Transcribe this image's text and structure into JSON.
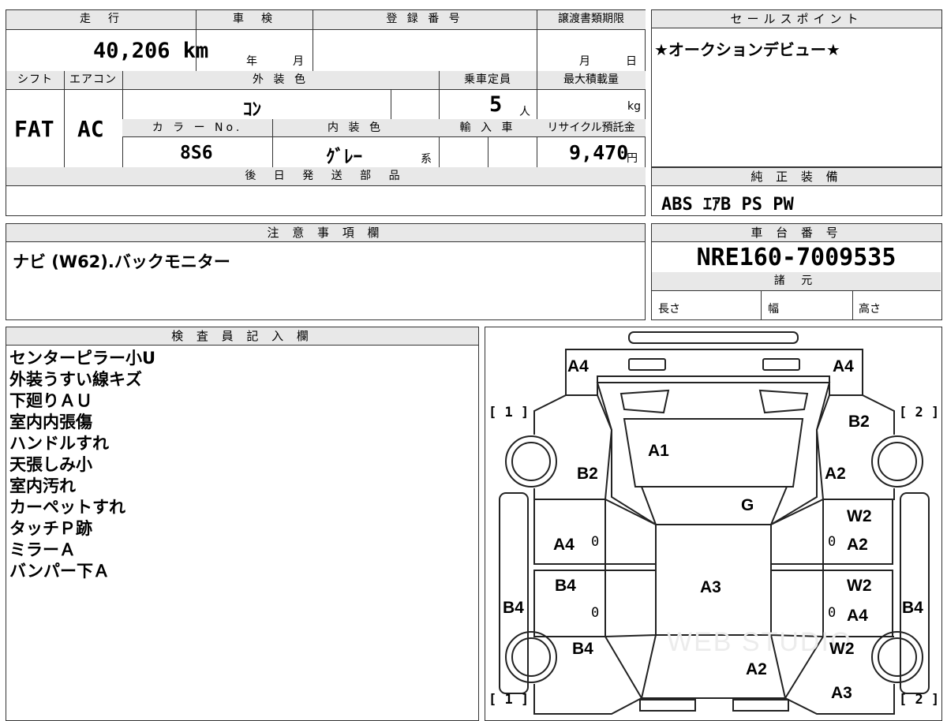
{
  "top_table": {
    "mileage": {
      "header": "走　行",
      "value": "40,206 km"
    },
    "inspection": {
      "header": "車　検",
      "year_unit": "年",
      "month_unit": "月"
    },
    "registration": {
      "header": "登 録 番 号",
      "value": ""
    },
    "transfer_deadline": {
      "header": "譲渡書類期限",
      "month_unit": "月",
      "day_unit": "日"
    },
    "shift": {
      "header": "シフト",
      "value": "FAT"
    },
    "aircon": {
      "header": "エアコン",
      "value": "AC"
    },
    "exterior_color": {
      "header": "外 装 色",
      "value": "ｺﾝ"
    },
    "capacity": {
      "header": "乗車定員",
      "value": "5",
      "unit": "人"
    },
    "max_load": {
      "header": "最大積載量",
      "unit": "kg"
    },
    "color_no": {
      "header": "カ ラ ー No.",
      "value": "8S6"
    },
    "interior_color": {
      "header": "内 装 色",
      "value": "ｸﾞﾚｰ",
      "suffix": "系"
    },
    "import": {
      "header": "輸 入 車"
    },
    "recycle_fee": {
      "header": "リサイクル預託金",
      "value": "9,470",
      "unit": "円"
    },
    "later_parts": {
      "header": "後 日 発 送 部 品",
      "value": ""
    }
  },
  "sales_point": {
    "header": "セールスポイント",
    "text": "★オークションデビュー★"
  },
  "genuine_equipment": {
    "header": "純 正 装 備",
    "text": "ABS ｴｱB PS PW"
  },
  "notes": {
    "header": "注 意 事 項 欄",
    "text": "ナビ (W62).バックモニター"
  },
  "chassis": {
    "header": "車 台 番 号",
    "value": "NRE160-7009535"
  },
  "specs": {
    "header": "諸 元",
    "length_label": "長さ",
    "width_label": "幅",
    "height_label": "高さ"
  },
  "inspector": {
    "header": "検 査 員 記 入 欄",
    "lines": [
      "センターピラー小U",
      "外装うすい線キズ",
      "下廻りＡＵ",
      "室内内張傷",
      "ハンドルすれ",
      "天張しみ小",
      "室内汚れ",
      "カーペットすれ",
      "タッチＰ跡",
      "ミラーＡ",
      "バンパー下Ａ"
    ]
  },
  "diagram": {
    "bracket_left": "[ 1 ]",
    "bracket_right": "[ 2 ]",
    "labels": {
      "a4_top_left": "A4",
      "a4_top_right": "A4",
      "b2_top_right": "B2",
      "a1": "A1",
      "b2_left": "B2",
      "a2_right": "A2",
      "g": "G",
      "w2_right1": "W2",
      "a4_left": "A4",
      "zero_left1": "0",
      "zero_right1": "0",
      "a2_right2": "A2",
      "b4_left": "B4",
      "w2_right2": "W2",
      "a3_center": "A3",
      "b4_far_left": "B4",
      "zero_left2": "0",
      "zero_right2": "0",
      "a4_right2": "A4",
      "b4_far_right": "B4",
      "b4_bottom_left": "B4",
      "w2_bottom_right": "W2",
      "a2_bottom": "A2",
      "a3_bottom_right": "A3"
    },
    "watermark": "WEB STUDIO"
  }
}
